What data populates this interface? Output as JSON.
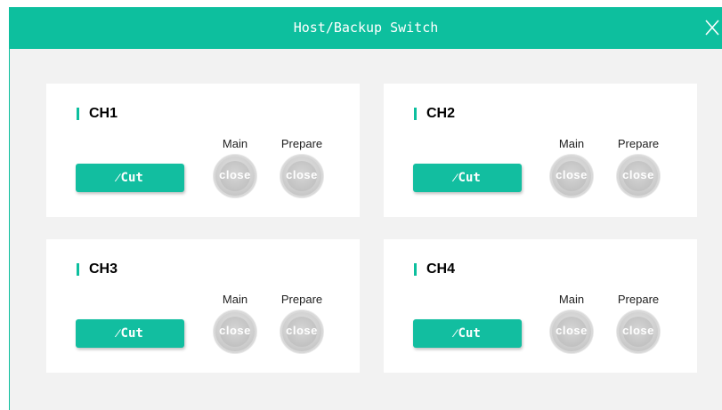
{
  "window": {
    "title": "Host/Backup Switch"
  },
  "icons": {
    "close": "close-icon",
    "cut": "switch-icon"
  },
  "colors": {
    "accent": "#0dbf9e",
    "lamp_off": "#c8c8c8"
  },
  "channels": [
    {
      "name": "CH1",
      "cut_label": "Cut",
      "main_label": "Main",
      "prepare_label": "Prepare",
      "main_state": "close",
      "prepare_state": "close"
    },
    {
      "name": "CH2",
      "cut_label": "Cut",
      "main_label": "Main",
      "prepare_label": "Prepare",
      "main_state": "close",
      "prepare_state": "close"
    },
    {
      "name": "CH3",
      "cut_label": "Cut",
      "main_label": "Main",
      "prepare_label": "Prepare",
      "main_state": "close",
      "prepare_state": "close"
    },
    {
      "name": "CH4",
      "cut_label": "Cut",
      "main_label": "Main",
      "prepare_label": "Prepare",
      "main_state": "close",
      "prepare_state": "close"
    }
  ]
}
